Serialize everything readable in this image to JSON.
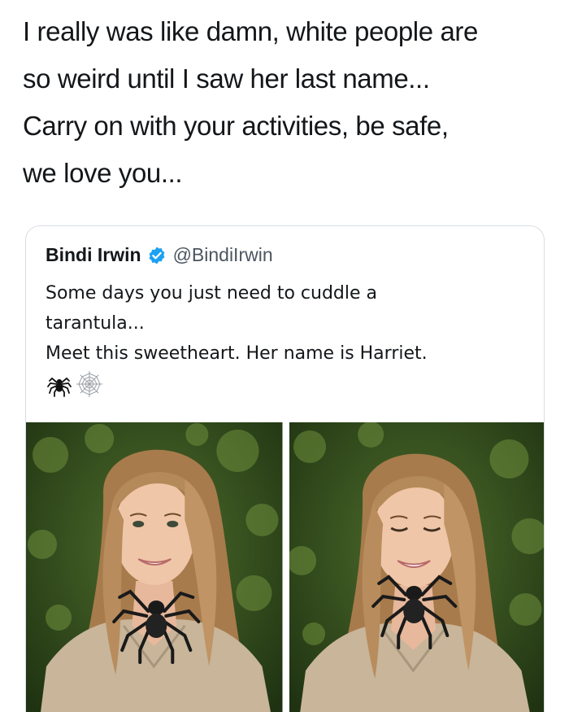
{
  "top_tweet": {
    "lines": [
      "I really was like damn, white people are",
      "so weird until I saw her last name...",
      "Carry on with your activities, be safe,",
      "we love you..."
    ]
  },
  "quoted_tweet": {
    "author_name": "Bindi Irwin",
    "handle": "@BindiIrwin",
    "verified": true,
    "verified_color": "#1da1f2",
    "body_lines": [
      "Some days you just need to cuddle a",
      "tarantula...",
      "Meet this sweetheart. Her name is Harriet."
    ],
    "emojis": [
      "spider-emoji",
      "spider-web-emoji"
    ],
    "photos": [
      {
        "name": "photo-left",
        "eyes": "open"
      },
      {
        "name": "photo-right",
        "eyes": "closed"
      }
    ]
  },
  "colors": {
    "text": "#14171a",
    "handle": "#4b5560",
    "border": "#d9dee3",
    "shirt": "#c8b59a",
    "hair": "#b58a5a",
    "foliage": "#2f4a1c"
  }
}
